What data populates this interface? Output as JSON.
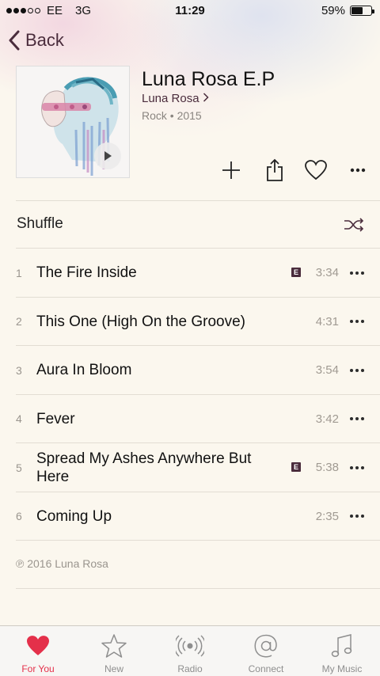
{
  "status_bar": {
    "carrier": "EE",
    "network": "3G",
    "time": "11:29",
    "battery": "59%",
    "battery_level": 0.59,
    "signal_bars_filled": 3,
    "signal_bars_total": 5
  },
  "nav": {
    "back_label": "Back"
  },
  "album": {
    "title": "Luna Rosa E.P",
    "artist": "Luna Rosa",
    "meta": "Rock • 2015"
  },
  "actions": {
    "icons": [
      "add-icon",
      "share-icon",
      "heart-icon",
      "more-icon"
    ]
  },
  "shuffle": {
    "label": "Shuffle"
  },
  "tracks": [
    {
      "number": "1",
      "title": "The Fire Inside",
      "explicit": true,
      "duration": "3:34"
    },
    {
      "number": "2",
      "title": "This One (High On the Groove)",
      "explicit": false,
      "duration": "4:31"
    },
    {
      "number": "3",
      "title": "Aura In Bloom",
      "explicit": false,
      "duration": "3:54"
    },
    {
      "number": "4",
      "title": "Fever",
      "explicit": false,
      "duration": "3:42"
    },
    {
      "number": "5",
      "title": "Spread My Ashes Anywhere But Here",
      "explicit": true,
      "duration": "5:38"
    },
    {
      "number": "6",
      "title": "Coming Up",
      "explicit": false,
      "duration": "2:35"
    }
  ],
  "explicit_badge": "E",
  "copyright": "℗ 2016 Luna Rosa",
  "tab_bar": {
    "tabs": [
      {
        "label": "For You",
        "icon": "heart-icon",
        "active": true
      },
      {
        "label": "New",
        "icon": "star-icon",
        "active": false
      },
      {
        "label": "Radio",
        "icon": "radio-icon",
        "active": false
      },
      {
        "label": "Connect",
        "icon": "at-icon",
        "active": false
      },
      {
        "label": "My Music",
        "icon": "music-note-icon",
        "active": false
      }
    ]
  },
  "colors": {
    "accent": "#4a2c3c",
    "tab_active": "#e4304a",
    "background": "#fbf7ee"
  }
}
